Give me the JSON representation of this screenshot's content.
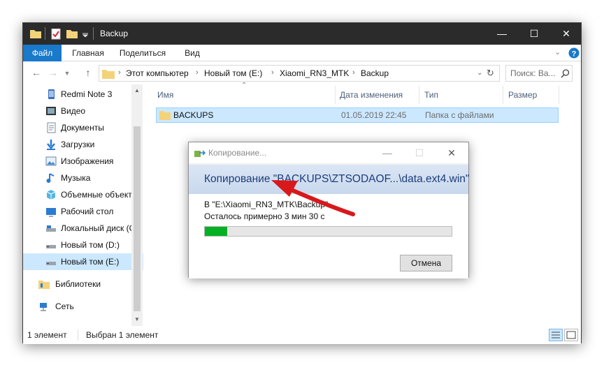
{
  "window": {
    "title": "Backup",
    "ribbon_tabs": [
      "Файл",
      "Главная",
      "Поделиться",
      "Вид"
    ]
  },
  "address": {
    "breadcrumbs": [
      "Этот компьютер",
      "Новый том (E:)",
      "Xiaomi_RN3_MTK",
      "Backup"
    ],
    "search_placeholder": "Поиск: Ba..."
  },
  "nav": {
    "items": [
      {
        "label": "Redmi Note 3",
        "icon": "phone-icon"
      },
      {
        "label": "Видео",
        "icon": "video-icon"
      },
      {
        "label": "Документы",
        "icon": "documents-icon"
      },
      {
        "label": "Загрузки",
        "icon": "downloads-icon"
      },
      {
        "label": "Изображения",
        "icon": "pictures-icon"
      },
      {
        "label": "Музыка",
        "icon": "music-icon"
      },
      {
        "label": "Объемные объект",
        "icon": "3d-objects-icon"
      },
      {
        "label": "Рабочий стол",
        "icon": "desktop-icon"
      },
      {
        "label": "Локальный диск (C",
        "icon": "drive-icon"
      },
      {
        "label": "Новый том (D:)",
        "icon": "drive-icon"
      },
      {
        "label": "Новый том (E:)",
        "icon": "drive-icon",
        "selected": true
      },
      {
        "label": "Библиотеки",
        "icon": "libraries-icon"
      },
      {
        "label": "Сеть",
        "icon": "network-icon"
      }
    ]
  },
  "columns": [
    "Имя",
    "Дата изменения",
    "Тип",
    "Размер"
  ],
  "files": [
    {
      "name": "BACKUPS",
      "date": "01.05.2019 22:45",
      "type": "Папка с файлами",
      "size": ""
    }
  ],
  "status": {
    "count": "1 элемент",
    "selected": "Выбран 1 элемент"
  },
  "dialog": {
    "title": "Копирование...",
    "heading": "Копирование \"BACKUPS\\ZTSODAOF...\\data.ext4.win\"",
    "destination": "В \"E:\\Xiaomi_RN3_MTK\\Backup\"",
    "remaining": "Осталось примерно 3 мин 30 с",
    "progress": 0.09,
    "cancel_label": "Отмена"
  },
  "colors": {
    "accent": "#1979ca",
    "selection": "#cce8ff",
    "progress": "#06b025",
    "annotation_arrow": "#d7191c"
  }
}
